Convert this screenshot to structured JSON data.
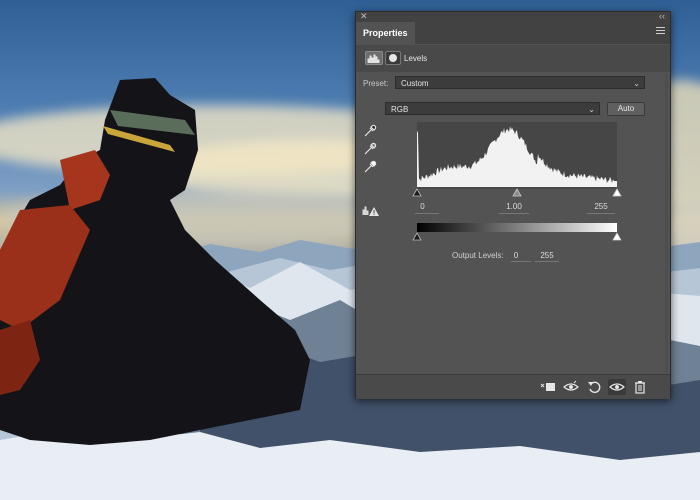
{
  "panel": {
    "tab_label": "Properties",
    "adjustment_title": "Levels",
    "preset_label": "Preset:",
    "preset_value": "Custom",
    "channel_value": "RGB",
    "auto_label": "Auto",
    "input": {
      "black": "0",
      "gamma": "1.00",
      "white": "255"
    },
    "output_label": "Output Levels:",
    "output": {
      "black": "0",
      "white": "255"
    }
  },
  "icons": {
    "panel_close": "close-icon",
    "panel_collapse": "collapse-icon",
    "panel_menu": "panel-menu-icon",
    "levels": "levels-adjustment-icon",
    "mask": "mask-icon",
    "eyedroppers": [
      "black-point-eyedropper-icon",
      "gray-point-eyedropper-icon",
      "white-point-eyedropper-icon"
    ],
    "clipping_warning": "clipping-warning-icon",
    "footer": [
      "clip-to-layer-icon",
      "view-previous-state-icon",
      "reset-icon",
      "visibility-icon",
      "delete-icon"
    ]
  },
  "colors": {
    "panel_bg": "#535353",
    "panel_header": "#424242",
    "field_bg": "#3c3c3c"
  }
}
